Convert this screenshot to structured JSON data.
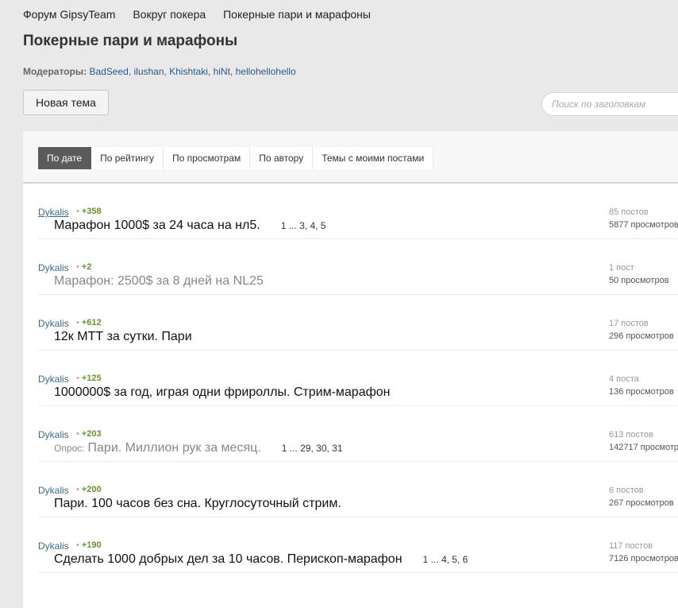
{
  "breadcrumb": [
    "Форум GipsyTeam",
    "Вокруг покера",
    "Покерные пари и марафоны"
  ],
  "page_title": "Покерные пари и марафоны",
  "moderators": {
    "label": "Модераторы:",
    "names": [
      "BadSeed",
      "ilushan",
      "Khishtaki",
      "hiNt",
      "hellohellohello"
    ]
  },
  "new_topic_label": "Новая тема",
  "search_placeholder": "Поиск по заголовкам",
  "tabs": [
    "По дате",
    "По рейтингу",
    "По просмотрам",
    "По автору",
    "Темы с моими постами"
  ],
  "active_tab": 0,
  "topics": [
    {
      "author": "Dykalis",
      "rating": "+358",
      "poll": "",
      "title": "Марафон 1000$ за 24 часа на нл5.",
      "read": false,
      "pages": [
        "1",
        "...",
        "3,",
        "4,",
        "5"
      ],
      "posts": "85 постов",
      "views": "5877 просмотров"
    },
    {
      "author": "Dykalis",
      "rating": "+2",
      "poll": "",
      "title": "Марафон: 2500$ за 8 дней на NL25",
      "read": true,
      "pages": [],
      "posts": "1 пост",
      "views": "50 просмотров"
    },
    {
      "author": "Dykalis",
      "rating": "+612",
      "poll": "",
      "title": "12к МТТ за сутки. Пари",
      "read": false,
      "pages": [],
      "posts": "17 постов",
      "views": "296 просмотров"
    },
    {
      "author": "Dykalis",
      "rating": "+125",
      "poll": "",
      "title": "1000000$ за год, играя одни фрироллы. Стрим-марафон",
      "read": false,
      "pages": [],
      "posts": "4 поста",
      "views": "136 просмотров"
    },
    {
      "author": "Dykalis",
      "rating": "+203",
      "poll": "Опрос:",
      "title": "Пари. Миллион рук за месяц.",
      "read": true,
      "pages": [
        "1",
        "...",
        "29,",
        "30,",
        "31"
      ],
      "posts": "613 постов",
      "views": "142717 просмотров"
    },
    {
      "author": "Dykalis",
      "rating": "+200",
      "poll": "",
      "title": "Пари. 100 часов без сна. Круглосуточный стрим.",
      "read": false,
      "pages": [],
      "posts": "6 постов",
      "views": "267 просмотров"
    },
    {
      "author": "Dykalis",
      "rating": "+190",
      "poll": "",
      "title": "Сделать 1000 добрых дел за 10 часов. Перископ-марафон",
      "read": false,
      "pages": [
        "1",
        "...",
        "4,",
        "5,",
        "6"
      ],
      "posts": "117 постов",
      "views": "7126 просмотров"
    }
  ],
  "colors": {
    "active_tab_bg": "#5b5b5b",
    "rating_green": "#6b8f3a",
    "link_blue": "#2a5a8a"
  }
}
